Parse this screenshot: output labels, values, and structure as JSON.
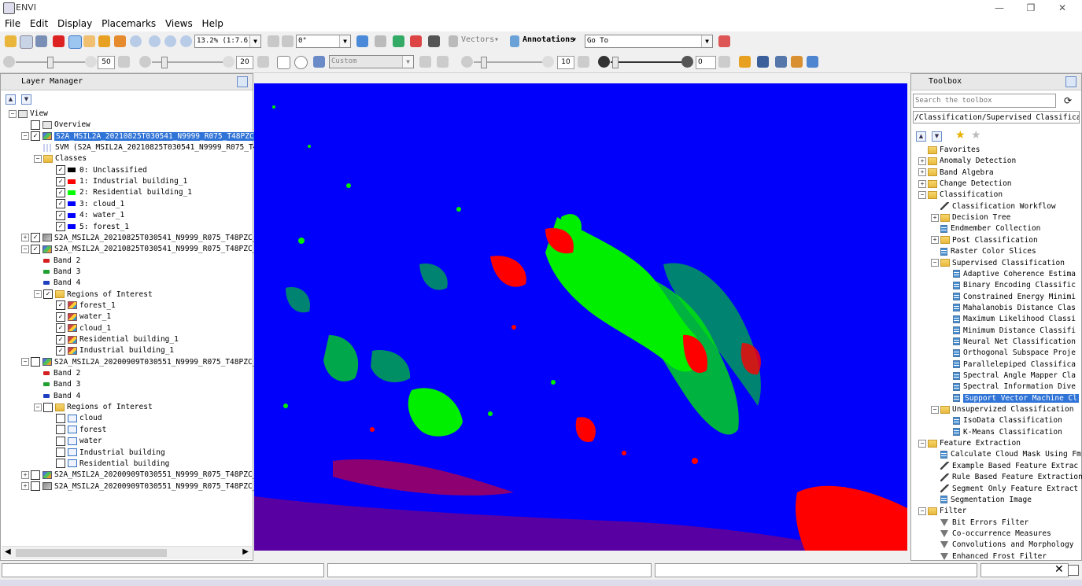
{
  "window": {
    "title": "ENVI"
  },
  "menu": [
    "File",
    "Edit",
    "Display",
    "Placemarks",
    "Views",
    "Help"
  ],
  "toolbar": {
    "zoom_value": "13.2% (1:7.6)",
    "rotation_value": "0°",
    "vectors_label": "Vectors",
    "annotations_label": "Annotations",
    "goto_value": "Go To",
    "slider1_value": "50",
    "slider2_value": "20",
    "stretch_value": "Custom",
    "slider3_value": "10",
    "slider4_value": "0"
  },
  "layer_manager": {
    "title": "Layer Manager",
    "rows": [
      {
        "text": "View",
        "depth": 0,
        "icon": "view",
        "exp": "-",
        "chk": null
      },
      {
        "text": "Overview",
        "depth": 1,
        "icon": "view",
        "exp": null,
        "chk": false
      },
      {
        "text": "S2A_MSIL2A_20210825T030541_N9999_R075_T48PZC_",
        "depth": 1,
        "icon": "raster",
        "exp": "-",
        "chk": true,
        "selected": true
      },
      {
        "text": "SVM (S2A_MSIL2A_20210825T030541_N9999_R075_T48",
        "depth": 2,
        "icon": "svm",
        "exp": null,
        "chk": null
      },
      {
        "text": "Classes",
        "depth": 2,
        "icon": "folder",
        "exp": "-",
        "chk": null
      },
      {
        "text": "0: Unclassified",
        "depth": 3,
        "icon": "swatch",
        "color": "#000000",
        "exp": null,
        "chk": true
      },
      {
        "text": "1: Industrial building_1",
        "depth": 3,
        "icon": "swatch",
        "color": "#ff0000",
        "exp": null,
        "chk": true
      },
      {
        "text": "2: Residential building_1",
        "depth": 3,
        "icon": "swatch",
        "color": "#00ff00",
        "exp": null,
        "chk": true
      },
      {
        "text": "3: cloud_1",
        "depth": 3,
        "icon": "swatch",
        "color": "#0000ff",
        "exp": null,
        "chk": true
      },
      {
        "text": "4: water_1",
        "depth": 3,
        "icon": "swatch",
        "color": "#0000ff",
        "exp": null,
        "chk": true
      },
      {
        "text": "5: forest_1",
        "depth": 3,
        "icon": "swatch",
        "color": "#0000ff",
        "exp": null,
        "chk": true
      },
      {
        "text": "S2A_MSIL2A_20210825T030541_N9999_R075_T48PZC_",
        "depth": 1,
        "icon": "graylayer",
        "exp": "+",
        "chk": true
      },
      {
        "text": "S2A_MSIL2A_20210825T030541_N9999_R075_T48PZC_",
        "depth": 1,
        "icon": "raster",
        "exp": "-",
        "chk": true
      },
      {
        "text": "Band 2",
        "depth": 2,
        "icon": "band",
        "color": "#d42020",
        "exp": null,
        "chk": null
      },
      {
        "text": "Band 3",
        "depth": 2,
        "icon": "band",
        "color": "#20a030",
        "exp": null,
        "chk": null
      },
      {
        "text": "Band 4",
        "depth": 2,
        "icon": "band",
        "color": "#2040c0",
        "exp": null,
        "chk": null
      },
      {
        "text": "Regions of Interest",
        "depth": 2,
        "icon": "folder",
        "exp": "-",
        "chk": true
      },
      {
        "text": "forest_1",
        "depth": 3,
        "icon": "roi",
        "exp": null,
        "chk": true
      },
      {
        "text": "water_1",
        "depth": 3,
        "icon": "roi",
        "exp": null,
        "chk": true
      },
      {
        "text": "cloud_1",
        "depth": 3,
        "icon": "roi",
        "exp": null,
        "chk": true
      },
      {
        "text": "Residential building_1",
        "depth": 3,
        "icon": "roi",
        "exp": null,
        "chk": true
      },
      {
        "text": "Industrial building_1",
        "depth": 3,
        "icon": "roi",
        "exp": null,
        "chk": true
      },
      {
        "text": "S2A_MSIL2A_20200909T030551_N9999_R075_T48PZC_",
        "depth": 1,
        "icon": "raster",
        "exp": "-",
        "chk": false
      },
      {
        "text": "Band 2",
        "depth": 2,
        "icon": "band",
        "color": "#d42020",
        "exp": null,
        "chk": null
      },
      {
        "text": "Band 3",
        "depth": 2,
        "icon": "band",
        "color": "#20a030",
        "exp": null,
        "chk": null
      },
      {
        "text": "Band 4",
        "depth": 2,
        "icon": "band",
        "color": "#2040c0",
        "exp": null,
        "chk": null
      },
      {
        "text": "Regions of Interest",
        "depth": 2,
        "icon": "folder",
        "exp": "-",
        "chk": false
      },
      {
        "text": "cloud",
        "depth": 3,
        "icon": "roi-empty",
        "exp": null,
        "chk": false
      },
      {
        "text": "forest",
        "depth": 3,
        "icon": "roi-empty",
        "exp": null,
        "chk": false
      },
      {
        "text": "water",
        "depth": 3,
        "icon": "roi-empty",
        "exp": null,
        "chk": false
      },
      {
        "text": "Industrial building",
        "depth": 3,
        "icon": "roi-empty",
        "exp": null,
        "chk": false
      },
      {
        "text": "Residential building",
        "depth": 3,
        "icon": "roi-empty",
        "exp": null,
        "chk": false
      },
      {
        "text": "S2A_MSIL2A_20200909T030551_N9999_R075_T48PZC_",
        "depth": 1,
        "icon": "raster",
        "exp": "+",
        "chk": false
      },
      {
        "text": "S2A_MSIL2A_20200909T030551_N9999_R075_T48PZC_",
        "depth": 1,
        "icon": "graylayer",
        "exp": "+",
        "chk": false
      }
    ]
  },
  "toolbox": {
    "title": "Toolbox",
    "search_placeholder": "Search the toolbox",
    "path": "/Classification/Supervised Classification",
    "rows": [
      {
        "text": "Favorites",
        "depth": 0,
        "icon": "folder-star",
        "exp": null
      },
      {
        "text": "Anomaly Detection",
        "depth": 0,
        "icon": "folder",
        "exp": "+"
      },
      {
        "text": "Band Algebra",
        "depth": 0,
        "icon": "folder",
        "exp": "+"
      },
      {
        "text": "Change Detection",
        "depth": 0,
        "icon": "folder",
        "exp": "+"
      },
      {
        "text": "Classification",
        "depth": 0,
        "icon": "folder",
        "exp": "-"
      },
      {
        "text": "Classification Workflow",
        "depth": 1,
        "icon": "wand",
        "exp": null
      },
      {
        "text": "Decision Tree",
        "depth": 1,
        "icon": "folder",
        "exp": "+"
      },
      {
        "text": "Endmember Collection",
        "depth": 1,
        "icon": "tool",
        "exp": null
      },
      {
        "text": "Post Classification",
        "depth": 1,
        "icon": "folder",
        "exp": "+"
      },
      {
        "text": "Raster Color Slices",
        "depth": 1,
        "icon": "tool",
        "exp": null
      },
      {
        "text": "Supervised Classification",
        "depth": 1,
        "icon": "folder",
        "exp": "-"
      },
      {
        "text": "Adaptive Coherence Estima",
        "depth": 2,
        "icon": "tool",
        "exp": null
      },
      {
        "text": "Binary Encoding Classific",
        "depth": 2,
        "icon": "tool",
        "exp": null
      },
      {
        "text": "Constrained Energy Minimi",
        "depth": 2,
        "icon": "tool",
        "exp": null
      },
      {
        "text": "Mahalanobis Distance Clas",
        "depth": 2,
        "icon": "tool",
        "exp": null
      },
      {
        "text": "Maximum Likelihood Classi",
        "depth": 2,
        "icon": "tool",
        "exp": null
      },
      {
        "text": "Minimum Distance Classifi",
        "depth": 2,
        "icon": "tool",
        "exp": null
      },
      {
        "text": "Neural Net Classification",
        "depth": 2,
        "icon": "tool",
        "exp": null
      },
      {
        "text": "Orthogonal Subspace Proje",
        "depth": 2,
        "icon": "tool",
        "exp": null
      },
      {
        "text": "Parallelepiped Classifica",
        "depth": 2,
        "icon": "tool",
        "exp": null
      },
      {
        "text": "Spectral Angle Mapper Cla",
        "depth": 2,
        "icon": "tool",
        "exp": null
      },
      {
        "text": "Spectral Information Dive",
        "depth": 2,
        "icon": "tool",
        "exp": null
      },
      {
        "text": "Support Vector Machine Cl",
        "depth": 2,
        "icon": "tool",
        "exp": null,
        "selected": true
      },
      {
        "text": "Unsupervized Classification",
        "depth": 1,
        "icon": "folder",
        "exp": "-"
      },
      {
        "text": "IsoData Classification",
        "depth": 2,
        "icon": "tool",
        "exp": null
      },
      {
        "text": "K-Means Classification",
        "depth": 2,
        "icon": "tool",
        "exp": null
      },
      {
        "text": "Feature Extraction",
        "depth": 0,
        "icon": "folder",
        "exp": "-"
      },
      {
        "text": "Calculate Cloud Mask Using Fm",
        "depth": 1,
        "icon": "tool",
        "exp": null
      },
      {
        "text": "Example Based Feature Extrac",
        "depth": 1,
        "icon": "wand",
        "exp": null
      },
      {
        "text": "Rule Based Feature Extraction",
        "depth": 1,
        "icon": "wand",
        "exp": null
      },
      {
        "text": "Segment Only Feature Extract",
        "depth": 1,
        "icon": "wand",
        "exp": null
      },
      {
        "text": "Segmentation Image",
        "depth": 1,
        "icon": "tool",
        "exp": null
      },
      {
        "text": "Filter",
        "depth": 0,
        "icon": "folder",
        "exp": "-"
      },
      {
        "text": "Bit Errors Filter",
        "depth": 1,
        "icon": "funnel",
        "exp": null
      },
      {
        "text": "Co-occurrence Measures",
        "depth": 1,
        "icon": "funnel",
        "exp": null
      },
      {
        "text": "Convolutions and Morphology",
        "depth": 1,
        "icon": "funnel",
        "exp": null
      },
      {
        "text": "Enhanced Frost Filter",
        "depth": 1,
        "icon": "funnel",
        "exp": null
      }
    ]
  },
  "colors": {
    "class_map_background": "#0000fb",
    "industrial": "#ff0000",
    "residential": "#00ee00",
    "selection": "#3074d7"
  }
}
